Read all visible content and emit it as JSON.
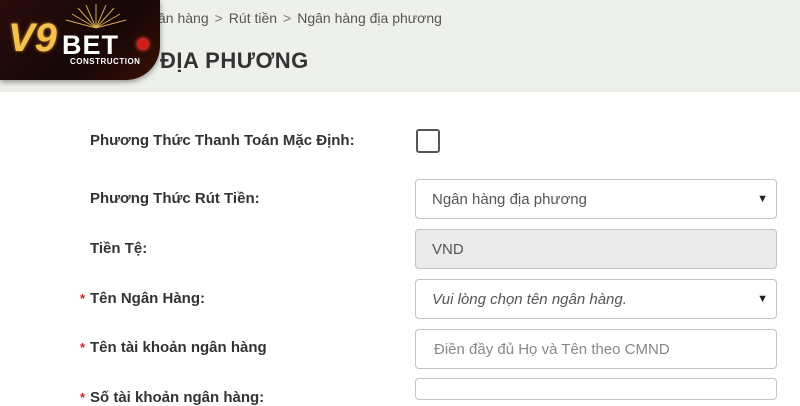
{
  "logo": {
    "main": "V9",
    "brand": "BET",
    "sub": "CONSTRUCTION"
  },
  "breadcrumb": {
    "items": [
      "ân hàng",
      "Rút tiền",
      "Ngân hàng địa phương"
    ],
    "separator": ">"
  },
  "page_title": "ĐỊA PHƯƠNG",
  "form": {
    "default_payment": {
      "label": "Phương Thức Thanh Toán Mặc Định:",
      "checked": false
    },
    "withdraw_method": {
      "label": "Phương Thức Rút Tiền:",
      "value": "Ngân hàng địa phương"
    },
    "currency": {
      "label": "Tiền Tệ:",
      "value": "VND"
    },
    "bank_name": {
      "required_mark": "*",
      "label": "Tên Ngân Hàng:",
      "value": "Vui lòng chọn tên ngân hàng."
    },
    "account_name": {
      "required_mark": "*",
      "label": "Tên tài khoản ngân hàng",
      "placeholder": "Điền đầy đủ Họ và Tên theo CMND"
    },
    "account_number": {
      "required_mark": "*",
      "label": "Số tài khoản ngân hàng:",
      "placeholder": ""
    }
  },
  "icons": {
    "dropdown": "caret-down-icon",
    "caret_glyph": "▼"
  },
  "colors": {
    "required": "#d0252a",
    "header_bg": "#eef0ec",
    "logo_gold": "#f2c14e"
  }
}
